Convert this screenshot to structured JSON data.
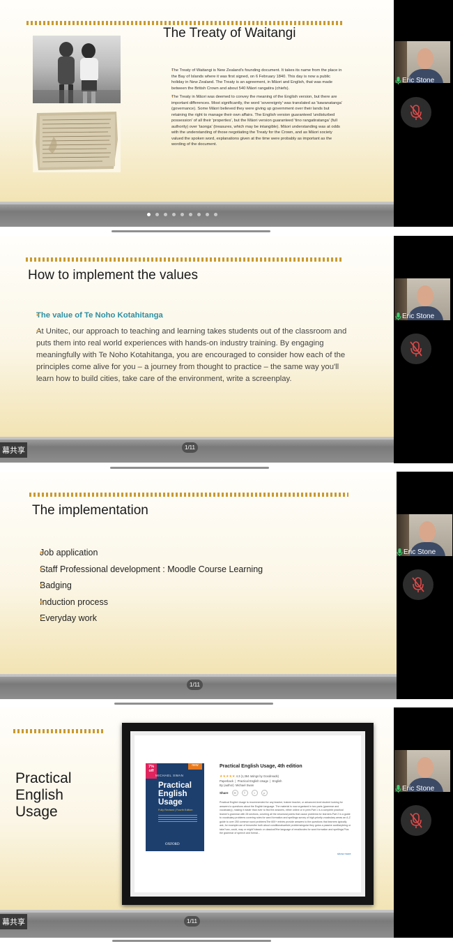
{
  "panel1": {
    "title": "The Treaty of Waitangi",
    "paragraph1": "The Treaty of Waitangi is New Zealand's founding document. It takes its name from the place in the Bay of Islands where it was first signed, on 6 February 1840. This day is now a public holiday in New Zealand. The Treaty is an agreement, in Māori and English, that was made between the British Crown and about 540 Māori rangatira (chiefs).",
    "paragraph2": "The Treaty in Māori was deemed to convey the meaning of the English version, but there are important differences. Most significantly, the word 'sovereignty' was translated as 'kawanatanga' (governance). Some Māori believed they were giving up government over their lands but retaining the right to manage their own affairs. The English version guaranteed 'undisturbed possession' of all their 'properties', but the Māori version guaranteed 'tino rangatiratanga' (full authority) over 'taonga' (treasures, which may be intangible). Māori understanding was at odds with the understanding of those negotiating the Treaty for the Crown, and as Māori society valued the spoken word, explanations given at the time were probably as important as the wording of the document.",
    "carousel_total": 9,
    "carousel_active": 1
  },
  "panel2": {
    "title": "How to implement the values",
    "highlight": "The value of Te Noho Kotahitanga",
    "body": "At Unitec, our approach to teaching and learning takes students out of the classroom and puts them into real world experiences with hands-on industry training. By engaging meaningfully with Te Noho Kotahitanga, you are encouraged to consider how each of the principles come alive for you – a journey from thought to practice – the same way you'll learn how to build cities, take care of the environment, write a screenplay.",
    "page": "1/11",
    "share_label": "幕共享"
  },
  "panel3": {
    "title": "The implementation",
    "items": [
      "Job application",
      "Staff Professional development : Moodle Course Learning",
      "Badging",
      "Induction process",
      "Everyday work"
    ],
    "page": "1/11"
  },
  "panel4": {
    "title_lines": [
      "Practical",
      "English",
      "Usage"
    ],
    "page": "1/11",
    "share_label": "幕共享",
    "book": {
      "discount": "7% off",
      "badge": "new",
      "author": "MICHAEL SWAN",
      "cover_title_lines": [
        "Practical",
        "English",
        "Usage"
      ],
      "cover_sub": "Fully Revised | Fourth Edition",
      "publisher": "OXFORD",
      "heading": "Practical English Usage, 4th edition",
      "rating": "4.3 (1,364 ratings by Goodreads)",
      "format": "Paperback  |  Practical English Usage  |  English",
      "byline": "By (author)  Michael Swan",
      "share_label": "Share",
      "description": "Practical English Usage is recommended for any teacher, trainee teacher, or advanced-level student looking for answers to questions about the English language. The material is now organised in two parts (grammar and vocabulary), making it easier than ever to find the answers, either online or in print.Part 1 is a complete practical learner's grammar with 28 sections, covering all the structural points that cause problems for learners.Part 2 is a guide to vocabulary problems covering rules for word formation and spellings survey of high-priority vocabulary areas an A-Z guide to over 250 common word problemsThe 600+ entries provide answers to the questions that learners typically ask, for example:use of tensesthe truth about conditionalsarticle problemsingular they gotos a passive auxiliarybring or take?can, could, may or might?classic or classical?the language of emailsrules for word formation and spellings.Plus the grammar of speech and formal...",
      "show_more": "show more"
    }
  },
  "participant": {
    "name": "Eric Stone"
  },
  "colors": {
    "accent_gold": "#c99a2e",
    "bullet_orange": "#e6a23c",
    "highlight_teal": "#2e8fa3",
    "mic_red": "#e04848",
    "mic_green": "#3bd16f"
  }
}
